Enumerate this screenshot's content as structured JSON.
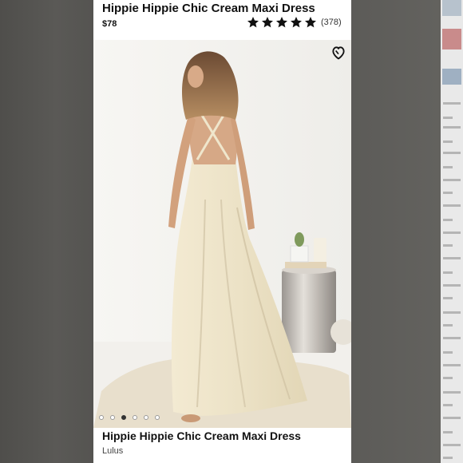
{
  "product": {
    "title": "Hippie Hippie Chic Cream Maxi Dress",
    "price": "$78",
    "rating_stars": 5,
    "review_count": "(378)",
    "brand": "Lulus"
  },
  "gallery": {
    "dot_count": 6,
    "active_index": 2
  },
  "icons": {
    "favorite": "heart-icon",
    "rating": "star-icon"
  },
  "colors": {
    "star": "#111111",
    "dress": "#efe6cc",
    "background": "#5b5a57"
  }
}
